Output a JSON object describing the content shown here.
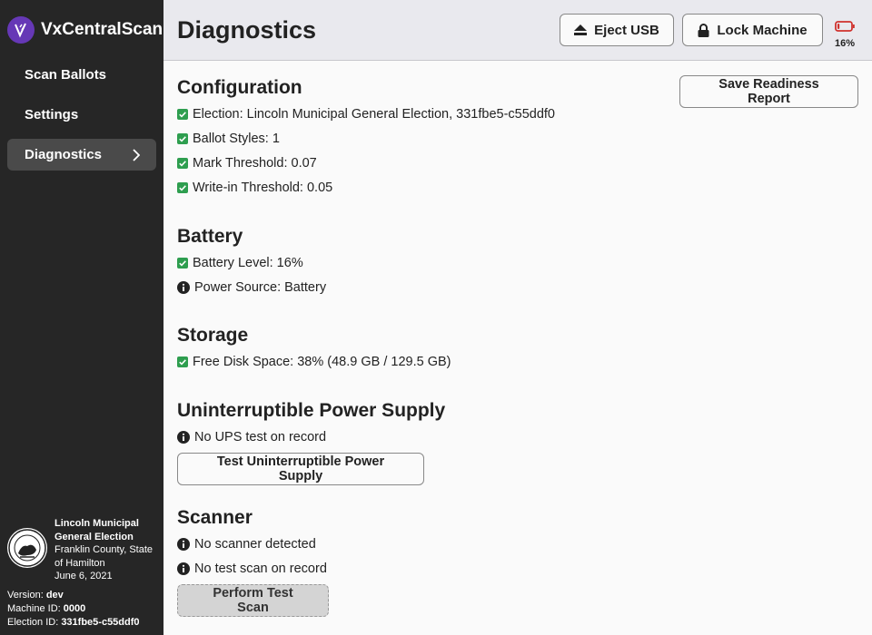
{
  "app": {
    "name": "VxCentralScan"
  },
  "nav": {
    "items": [
      {
        "label": "Scan Ballots"
      },
      {
        "label": "Settings"
      },
      {
        "label": "Diagnostics"
      }
    ]
  },
  "election": {
    "title": "Lincoln Municipal General Election",
    "county": "Franklin County, State of Hamilton",
    "date": "June 6, 2021"
  },
  "meta": {
    "version_label": "Version:",
    "version": "dev",
    "machine_label": "Machine ID:",
    "machine_id": "0000",
    "election_label": "Election ID:",
    "election_id": "331fbe5-c55ddf0"
  },
  "header": {
    "title": "Diagnostics",
    "eject_label": "Eject USB",
    "lock_label": "Lock Machine",
    "battery_percent": "16%",
    "battery_level": 0.16
  },
  "main": {
    "save_report_label": "Save Readiness Report",
    "configuration": {
      "heading": "Configuration",
      "items": [
        "Election: Lincoln Municipal General Election, 331fbe5-c55ddf0",
        "Ballot Styles: 1",
        "Mark Threshold: 0.07",
        "Write-in Threshold: 0.05"
      ]
    },
    "battery": {
      "heading": "Battery",
      "level": "Battery Level: 16%",
      "source": "Power Source: Battery"
    },
    "storage": {
      "heading": "Storage",
      "free": "Free Disk Space: 38% (48.9 GB / 129.5 GB)"
    },
    "ups": {
      "heading": "Uninterruptible Power Supply",
      "status": "No UPS test on record",
      "button": "Test Uninterruptible Power Supply"
    },
    "scanner": {
      "heading": "Scanner",
      "status": "No scanner detected",
      "test_status": "No test scan on record",
      "button": "Perform Test Scan"
    }
  },
  "colors": {
    "sidebar_bg": "#262626",
    "brand_purple": "#6638b6",
    "check_green": "#2e9e4f",
    "battery_red": "#d0312d"
  }
}
